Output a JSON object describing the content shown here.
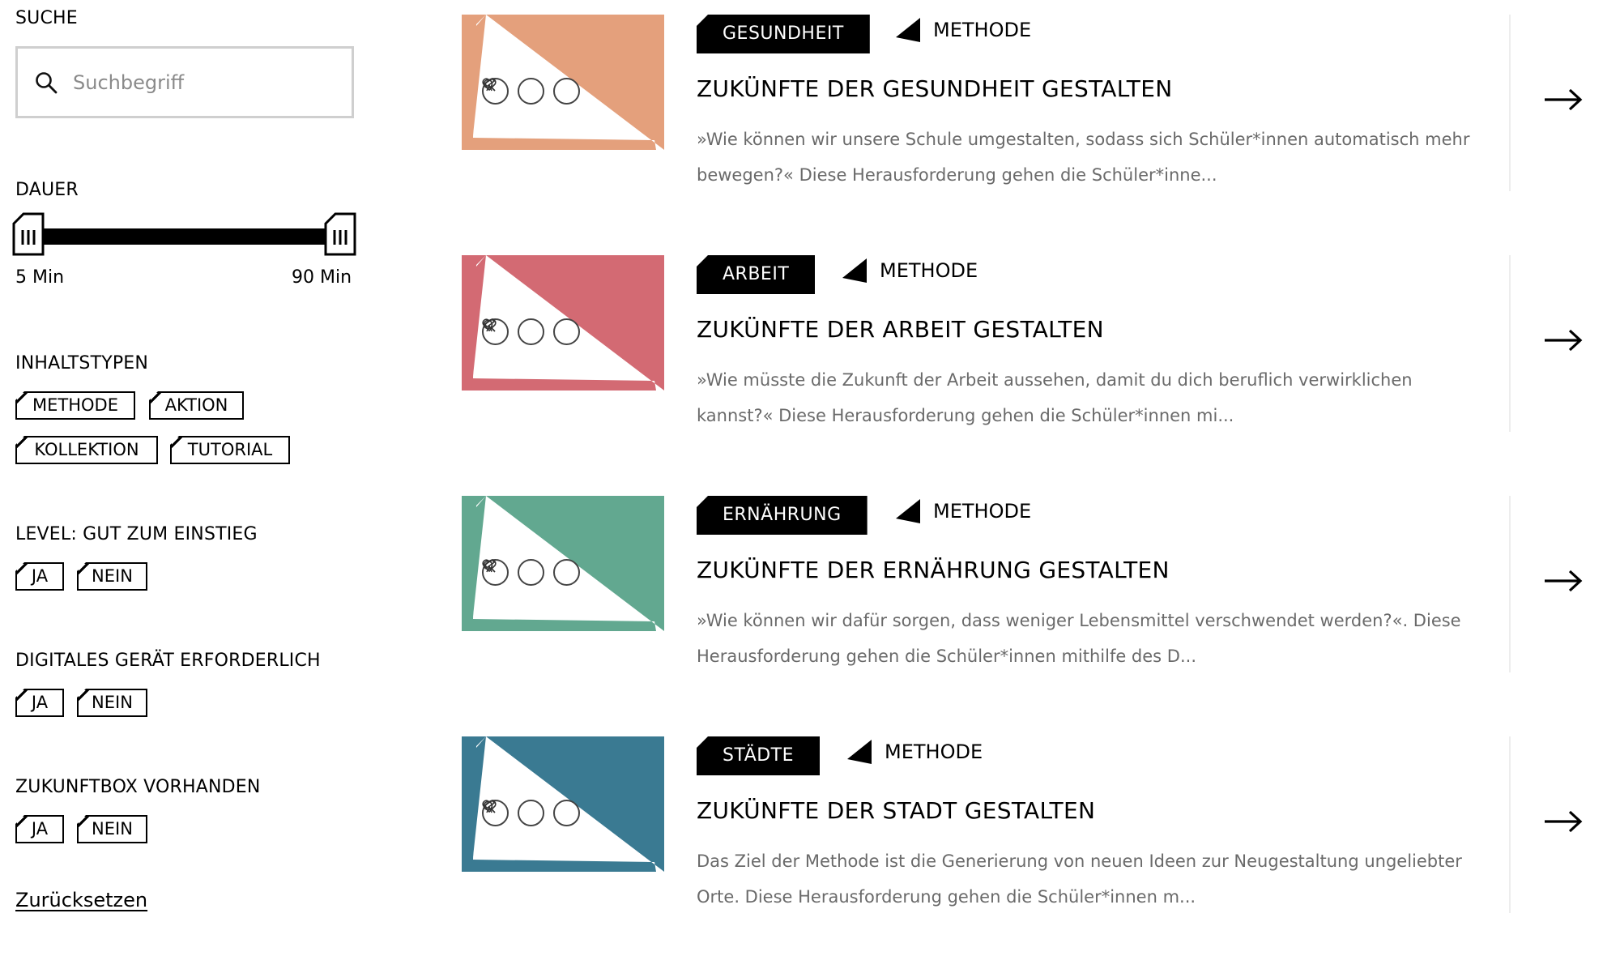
{
  "sidebar": {
    "search": {
      "heading": "SUCHE",
      "placeholder": "Suchbegriff"
    },
    "duration": {
      "heading": "DAUER",
      "min_label": "5 Min",
      "max_label": "90 Min",
      "selected_min": 5,
      "selected_max": 90
    },
    "content_types": {
      "heading": "INHALTSTYPEN",
      "options": [
        "METHODE",
        "AKTION",
        "KOLLEKTION",
        "TUTORIAL"
      ]
    },
    "level": {
      "heading": "LEVEL: GUT ZUM EINSTIEG",
      "options": [
        "JA",
        "NEIN"
      ]
    },
    "digital_device": {
      "heading": "DIGITALES GERÄT ERFORDERLICH",
      "options": [
        "JA",
        "NEIN"
      ]
    },
    "zukunftbox": {
      "heading": "ZUKUNFTBOX VORHANDEN",
      "options": [
        "JA",
        "NEIN"
      ]
    },
    "reset_label": "Zurücksetzen"
  },
  "cards": [
    {
      "category": "GESUNDHEIT",
      "type": "METHODE",
      "title": "ZUKÜNFTE DER GESUNDHEIT GESTALTEN",
      "description": "»Wie können wir unsere Schule umgestalten, sodass sich Schüler*innen automatisch mehr bewegen?« Diese Herausforderung gehen die Schüler*inne...",
      "color": "#E4A07C",
      "thumb_icons": [
        "heart-icon",
        "search-icon",
        "telescope-icon"
      ]
    },
    {
      "category": "ARBEIT",
      "type": "METHODE",
      "title": "ZUKÜNFTE DER ARBEIT GESTALTEN",
      "description": "»Wie müsste die Zukunft der Arbeit aussehen, damit du dich beruflich verwirklichen kannst?« Diese Herausforderung gehen die Schüler*innen mi...",
      "color": "#D36A73",
      "thumb_icons": [
        "heart-icon",
        "search-icon",
        "telescope-icon"
      ]
    },
    {
      "category": "ERNÄHRUNG",
      "type": "METHODE",
      "title": "ZUKÜNFTE DER ERNÄHRUNG GESTALTEN",
      "description": "»Wie können wir dafür sorgen, dass weniger Lebensmittel verschwendet werden?«. Diese Herausforderung gehen die Schüler*innen mithilfe des D...",
      "color": "#62A890",
      "thumb_icons": [
        "heart-icon",
        "search-icon",
        "telescope-icon"
      ]
    },
    {
      "category": "STÄDTE",
      "type": "METHODE",
      "title": "ZUKÜNFTE DER STADT GESTALTEN",
      "description": "Das Ziel der Methode ist die Generierung von neuen Ideen zur Neugestaltung ungeliebter Orte. Diese Herausforderung gehen die Schüler*innen m...",
      "color": "#3A7A92",
      "thumb_icons": [
        "heart-icon",
        "search-icon",
        "telescope-icon"
      ]
    }
  ]
}
